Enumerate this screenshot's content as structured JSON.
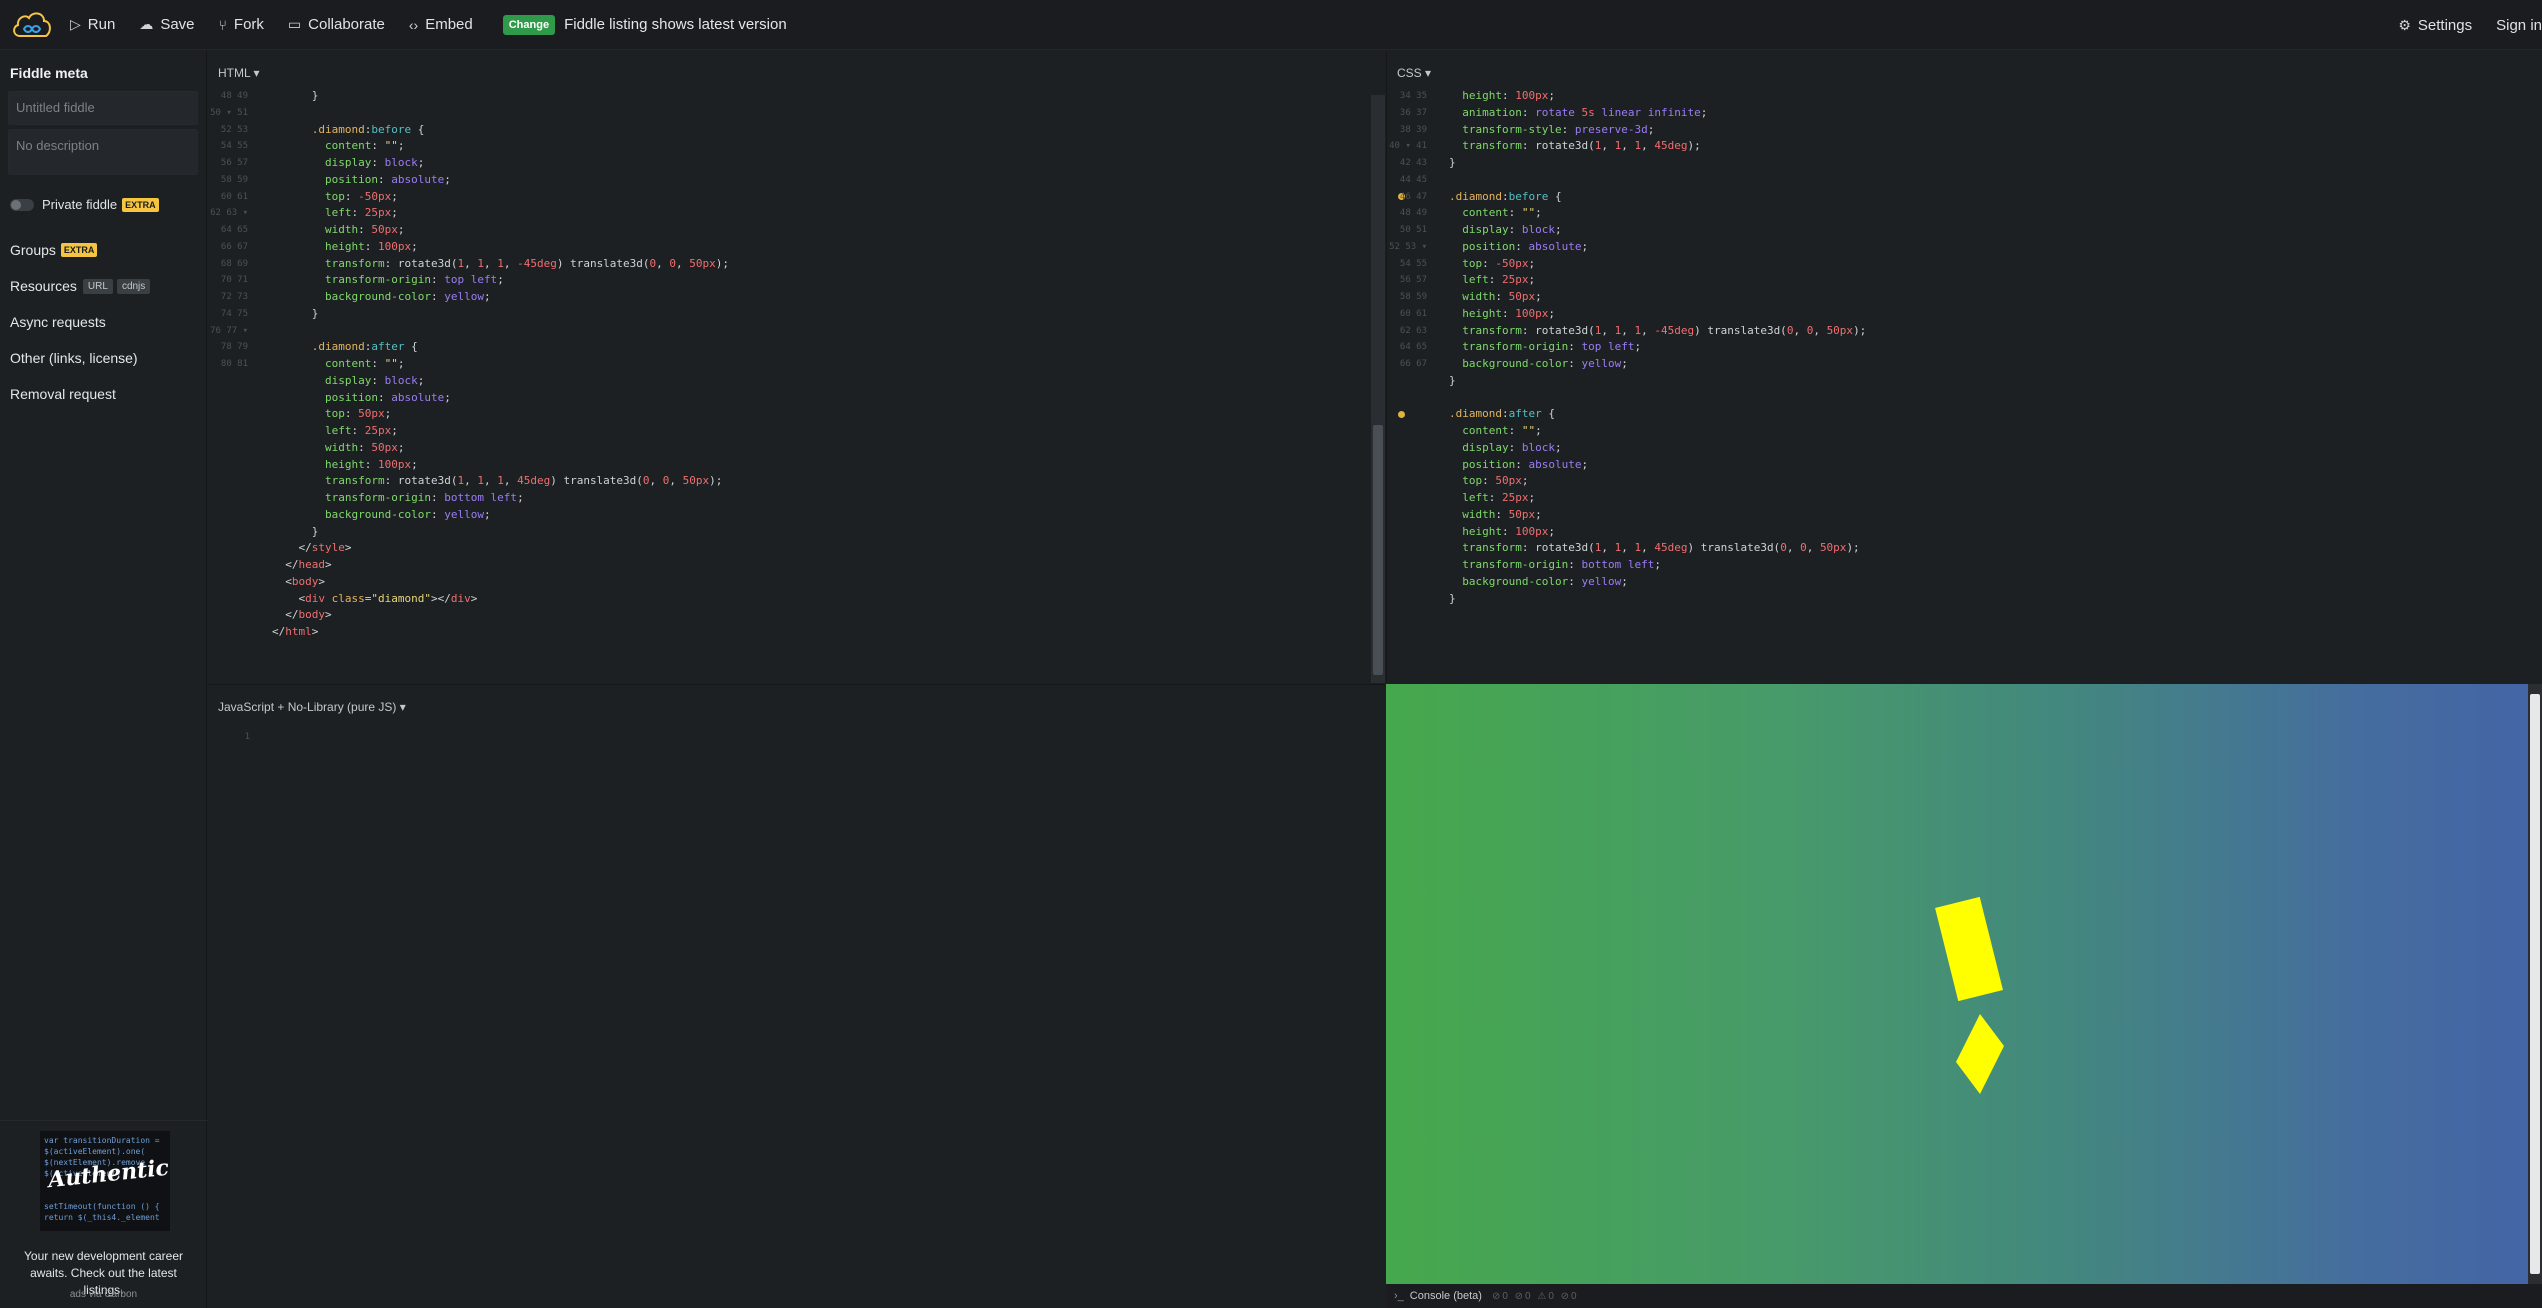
{
  "topbar": {
    "run": "Run",
    "save": "Save",
    "fork": "Fork",
    "collaborate": "Collaborate",
    "embed": "Embed",
    "change_badge": "Change",
    "listing": "Fiddle listing shows latest version",
    "settings": "Settings",
    "sign_in": "Sign in"
  },
  "sidebar": {
    "title": "Fiddle meta",
    "name_placeholder": "Untitled fiddle",
    "description_placeholder": "No description",
    "private_label": "Private fiddle",
    "extra_badge": "EXTRA",
    "groups": "Groups",
    "resources": "Resources",
    "tag_url": "URL",
    "tag_cdnjs": "cdnjs",
    "async": "Async requests",
    "other": "Other (links, license)",
    "removal": "Removal request"
  },
  "ad": {
    "image_text": "Authentic",
    "copy": "Your new development career awaits. Check out the latest listings.",
    "via": "ads via Carbon"
  },
  "panels": {
    "html_label": "HTML ▾",
    "css_label": "CSS ▾",
    "js_label": "JavaScript + No-Library (pure JS) ▾"
  },
  "console": {
    "label": "Console (beta)",
    "counts": "⊘0 ⊘0 ⚠0 ⊘0"
  }
}
